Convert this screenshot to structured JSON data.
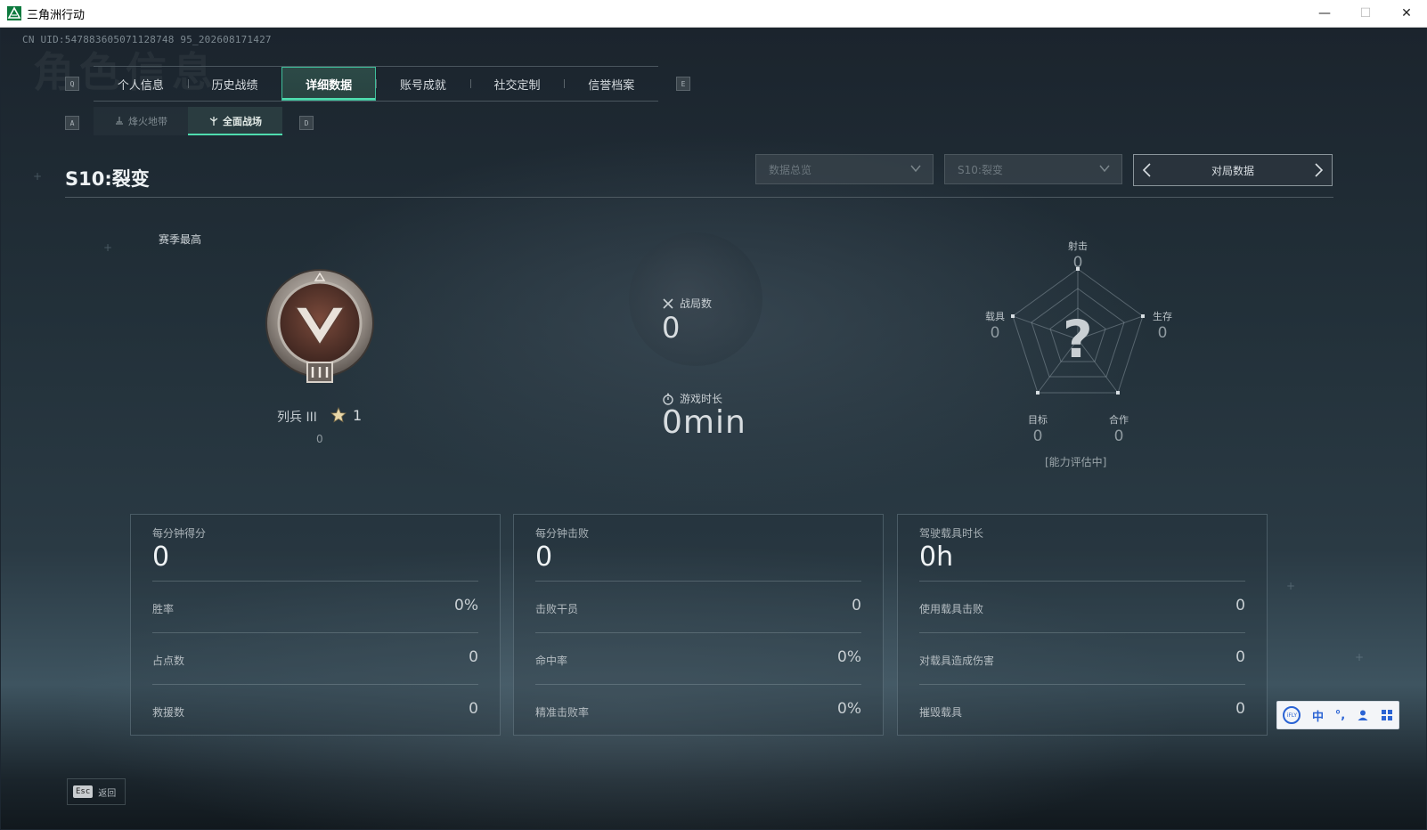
{
  "window": {
    "title": "三角洲行动",
    "controls": {
      "minimize": "—",
      "maximize": "☐",
      "close": "✕"
    }
  },
  "uid": "CN UID:547883605071128748 95_202608171427",
  "background_text": "角色信息",
  "main_tabs": {
    "key_left": "Q",
    "key_right": "E",
    "items": [
      {
        "label": "个人信息",
        "active": false
      },
      {
        "label": "历史战绩",
        "active": false
      },
      {
        "label": "详细数据",
        "active": true
      },
      {
        "label": "账号成就",
        "active": false
      },
      {
        "label": "社交定制",
        "active": false
      },
      {
        "label": "信誉档案",
        "active": false
      }
    ]
  },
  "sub_tabs": {
    "key_left": "A",
    "key_right": "D",
    "items": [
      {
        "label": "烽火地带",
        "icon": "zone-icon",
        "active": false
      },
      {
        "label": "全面战场",
        "icon": "battlefield-icon",
        "active": true
      }
    ]
  },
  "season": {
    "title": "S10:裂变",
    "filter_overview": "数据总览",
    "filter_season": "S10:裂变",
    "pager_label": "对局数据"
  },
  "rank": {
    "label": "赛季最高",
    "name": "列兵 III",
    "stars": "1",
    "points": "0"
  },
  "mid_stats": {
    "matches_label": "战局数",
    "matches_value": "0",
    "playtime_label": "游戏时长",
    "playtime_value": "0min"
  },
  "radar": {
    "shooting_label": "射击",
    "shooting_value": "0",
    "survival_label": "生存",
    "survival_value": "0",
    "teamwork_label": "合作",
    "teamwork_value": "0",
    "objective_label": "目标",
    "objective_value": "0",
    "vehicle_label": "载具",
    "vehicle_value": "0",
    "center_symbol": "?",
    "status": "[能力评估中]"
  },
  "cards": [
    {
      "head_label": "每分钟得分",
      "head_value": "0",
      "rows": [
        {
          "label": "胜率",
          "value": "0%"
        },
        {
          "label": "占点数",
          "value": "0"
        },
        {
          "label": "救援数",
          "value": "0"
        }
      ]
    },
    {
      "head_label": "每分钟击败",
      "head_value": "0",
      "rows": [
        {
          "label": "击败干员",
          "value": "0"
        },
        {
          "label": "命中率",
          "value": "0%"
        },
        {
          "label": "精准击败率",
          "value": "0%"
        }
      ]
    },
    {
      "head_label": "驾驶载具时长",
      "head_value": "0h",
      "rows": [
        {
          "label": "使用载具击败",
          "value": "0"
        },
        {
          "label": "对载具造成伤害",
          "value": "0"
        },
        {
          "label": "摧毁载具",
          "value": "0"
        }
      ]
    }
  ],
  "footer": {
    "esc_key": "Esc",
    "back_label": "返回"
  },
  "ime": {
    "brand": "iFLY",
    "mode": "中",
    "punct": "°,"
  },
  "colors": {
    "accent": "#4fdcae",
    "background": "#1c2630"
  }
}
